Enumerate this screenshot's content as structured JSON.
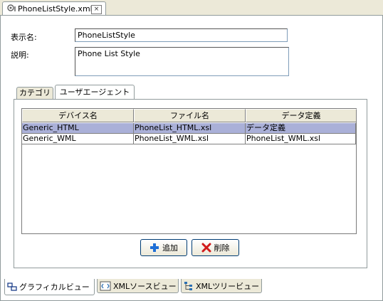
{
  "editor_tab": {
    "title": "PhoneListStyle.xml*",
    "close": "×"
  },
  "form": {
    "display_name_label": "表示名:",
    "display_name_value": "PhoneListStyle",
    "description_label": "説明:",
    "description_value": "Phone List Style"
  },
  "inner_tabs": [
    {
      "label": "カテゴリ",
      "active": false
    },
    {
      "label": "ユーザエージェント",
      "active": true
    }
  ],
  "table": {
    "columns": [
      "デバイス名",
      "ファイル名",
      "データ定義"
    ],
    "rows": [
      {
        "device": "Generic_HTML",
        "file": "PhoneList_HTML.xsl",
        "data": "データ定義",
        "selected": true
      },
      {
        "device": "Generic_WML",
        "file": "PhoneList_WML.xsl",
        "data": "PhoneList_WML.xsl",
        "selected": false
      }
    ]
  },
  "buttons": {
    "add": "追加",
    "delete": "削除"
  },
  "view_tabs": [
    {
      "label": "グラフィカルビュー",
      "icon": "graphical-view-icon",
      "active": true
    },
    {
      "label": "XMLソースビュー",
      "icon": "xml-source-icon",
      "active": false
    },
    {
      "label": "XMLツリービュー",
      "icon": "xml-tree-icon",
      "active": false
    }
  ],
  "colors": {
    "selected_row": "#aab0d8",
    "chrome": "#ece9d8",
    "add_icon": "#1f6fd6",
    "delete_icon": "#d11a1a"
  }
}
